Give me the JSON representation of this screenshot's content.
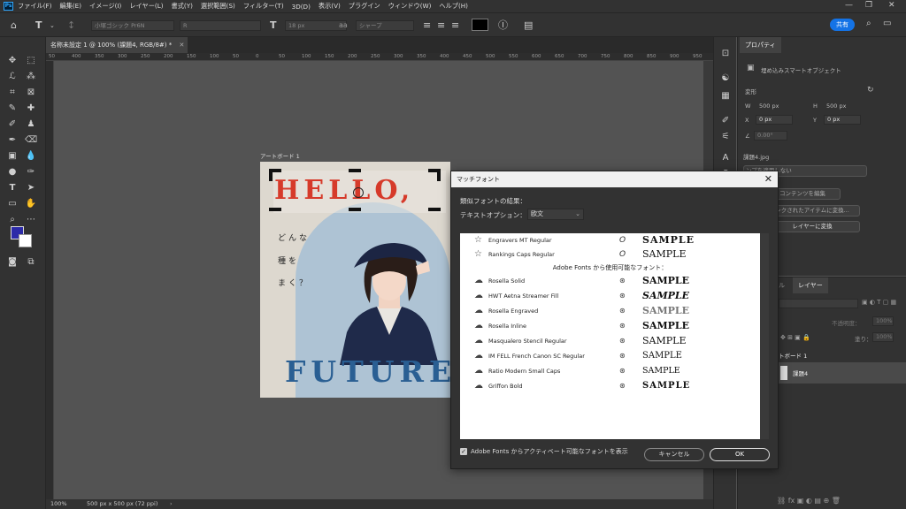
{
  "menubar": {
    "app_logo": "Ps",
    "items": [
      "ファイル(F)",
      "編集(E)",
      "イメージ(I)",
      "レイヤー(L)",
      "書式(Y)",
      "選択範囲(S)",
      "フィルター(T)",
      "3D(D)",
      "表示(V)",
      "プラグイン",
      "ウィンドウ(W)",
      "ヘルプ(H)"
    ],
    "window_controls": [
      "—",
      "❐",
      "✕"
    ]
  },
  "options": {
    "font_family": "小塚ゴシック Pr6N",
    "font_style": "R",
    "font_size": "18 px",
    "antialias_label": "aa",
    "antialias": "シャープ",
    "share": "共有"
  },
  "document": {
    "tab_title": "名称未設定 1 @ 100% (課題4, RGB/8#) *",
    "ruler_ticks": [
      "50",
      "400",
      "350",
      "300",
      "250",
      "200",
      "150",
      "100",
      "50",
      "0",
      "50",
      "100",
      "150",
      "200",
      "250",
      "300",
      "350",
      "400",
      "450",
      "500",
      "550",
      "600",
      "650",
      "700",
      "750",
      "800",
      "850",
      "900",
      "950"
    ],
    "artboard_label": "アートボード 1",
    "hello_text": "HELLO,",
    "jp_lines": [
      "どんな",
      "種を",
      "まく？"
    ],
    "future_text": "FUTURE"
  },
  "status": {
    "zoom": "100%",
    "doc_info": "500 px x 500 px (72 ppi)"
  },
  "properties": {
    "tab": "プロパティ",
    "object_type": "埋め込みスマートオブジェクト",
    "section": "変形",
    "w_label": "W",
    "w_value": "500 px",
    "h_label": "H",
    "h_value": "500 px",
    "x_label": "X",
    "x_value": "0 px",
    "y_label": "Y",
    "y_value": "0 px",
    "angle": "0.00°",
    "filename": "課題4.jpg",
    "btn_apply": "ンプを適用しない",
    "btn_edit": "コンテンツを編集",
    "btn_linked": "ンクされたアイテムに変換...",
    "btn_layer": "レイヤーに変換"
  },
  "layers": {
    "tab_channel": "ル",
    "tab_layers": "レイヤー",
    "opacity_label": "不透明度：",
    "opacity_value": "100%",
    "fill_label": "塗り：",
    "fill_value": "100%",
    "group": "トボード 1",
    "layer_name": "課題4"
  },
  "dialog": {
    "title": "マッチフォント",
    "results_label": "類似フォントの結果：",
    "text_option_label": "テキストオプション：",
    "text_option_value": "欧文",
    "adobe_header": "Adobe Fonts から使用可能なフォント：",
    "sample_text": "SAMPLE",
    "installed": [
      {
        "name": "Engravers MT Regular",
        "kind": "O",
        "sample": "SAMPLE"
      },
      {
        "name": "Rankings Caps Regular",
        "kind": "O",
        "sample": "SAMPLE"
      }
    ],
    "cloud": [
      {
        "name": "Rosella Solid",
        "sample": "SAMPLE"
      },
      {
        "name": "HWT Aetna Streamer Fill",
        "sample": "SAMPLE"
      },
      {
        "name": "Rosella Engraved",
        "sample": "SAMPLE"
      },
      {
        "name": "Rosella Inline",
        "sample": "SAMPLE"
      },
      {
        "name": "Masqualero Stencil Regular",
        "sample": "SAMPLE"
      },
      {
        "name": "IM FELL French Canon SC Regular",
        "sample": "SAMPLE"
      },
      {
        "name": "Ratio Modern Small Caps",
        "sample": "SAMPLE"
      },
      {
        "name": "Griffon Bold",
        "sample": "SAMPLE"
      }
    ],
    "checkbox_label": "Adobe Fonts からアクティベート可能なフォントを表示",
    "cancel": "キャンセル",
    "ok": "OK"
  },
  "colors": {
    "foreground": "#2c2aa8",
    "background": "#ffffff",
    "accent": "#1473e6",
    "hello": "#d63a2a",
    "future": "#2a5f93"
  }
}
